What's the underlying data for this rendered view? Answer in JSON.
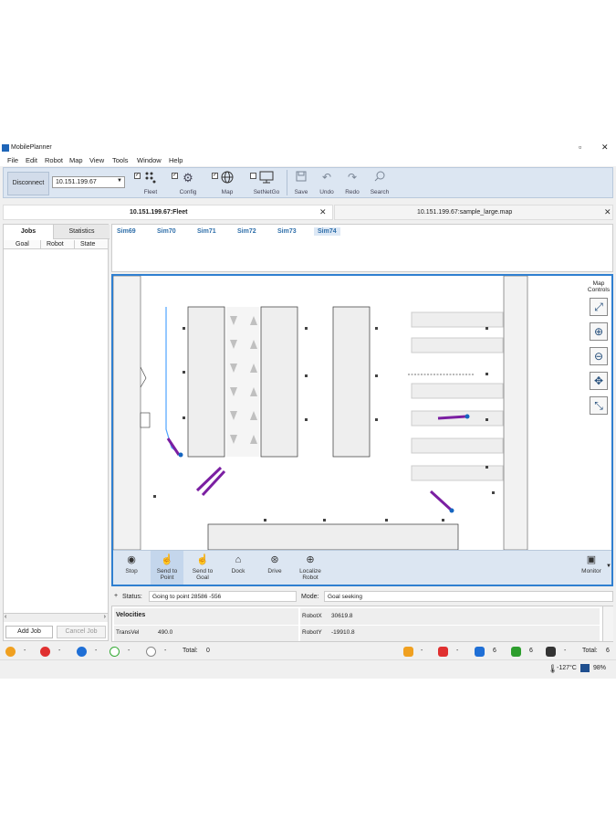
{
  "app": {
    "title": "MobilePlanner"
  },
  "window_controls": {
    "restore": "▫",
    "close": "✕"
  },
  "menu": [
    "File",
    "Edit",
    "Robot",
    "Map",
    "View",
    "Tools",
    "Window",
    "Help"
  ],
  "toolbar": {
    "disconnect_label": "Disconnect",
    "ip_value": "10.151.199.67",
    "fleet_label": "Fleet",
    "config_label": "Config",
    "map_label": "Map",
    "setnetgo_label": "SetNetGo",
    "save_label": "Save",
    "undo_label": "Undo",
    "redo_label": "Redo",
    "search_label": "Search"
  },
  "tabs": {
    "left": {
      "label": "10.151.199.67:Fleet",
      "close": "✕"
    },
    "right": {
      "label": "10.151.199.67:sample_large.map",
      "close": "✕"
    }
  },
  "left_panel": {
    "tabs": [
      "Jobs",
      "Statistics"
    ],
    "columns": [
      "Goal",
      "Robot",
      "State"
    ],
    "add_job": "Add Job",
    "cancel_job": "Cancel Job"
  },
  "robots": [
    "Sim69",
    "Sim70",
    "Sim71",
    "Sim72",
    "Sim73",
    "Sim74"
  ],
  "map_controls": {
    "title": "Map Controls"
  },
  "bottom_bar": {
    "stop": "Stop",
    "send_to_point": "Send to Point",
    "send_to_goal": "Send to Goal",
    "dock": "Dock",
    "drive": "Drive",
    "localize": "Localize Robot",
    "monitor": "Monitor"
  },
  "status": {
    "status_label": "Status:",
    "status_value": "Going to point 28586 -556",
    "mode_label": "Mode:",
    "mode_value": "Goal seeking"
  },
  "velocities": {
    "header": "Velocities",
    "transvel_label": "TransVel",
    "transvel_value": "490.0",
    "robotx_label": "RobotX",
    "robotx_value": "30619.8",
    "roboty_label": "RobotY",
    "roboty_value": "-19910.8"
  },
  "status_bar": {
    "dash": "-",
    "total_left_label": "Total:",
    "total_left_value": "0",
    "count_blue": "6",
    "count_green": "6",
    "total_right_label": "Total:",
    "total_right_value": "6"
  },
  "system": {
    "temperature": "-127°C",
    "battery": "98%"
  }
}
